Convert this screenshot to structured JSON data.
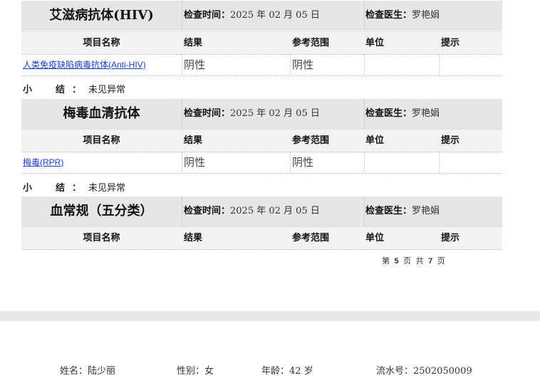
{
  "sections": [
    {
      "title": "艾滋病抗体(HIV)",
      "check_time_label": "检查时间：",
      "check_time": "2025 年 02 月 05 日",
      "doctor_label": "检查医生：",
      "doctor": "罗艳娟",
      "columns": [
        "项目名称",
        "结果",
        "参考范围",
        "单位",
        "提示"
      ],
      "rows": [
        {
          "name": "人类免疫缺陷病毒抗体(Anti-HIV)",
          "result": "阴性",
          "range": "阴性",
          "unit": "",
          "hint": ""
        }
      ],
      "summary_label": "小　结：",
      "summary": "未见异常"
    },
    {
      "title": "梅毒血清抗体",
      "check_time_label": "检查时间：",
      "check_time": "2025 年 02 月 05 日",
      "doctor_label": "检查医生：",
      "doctor": "罗艳娟",
      "columns": [
        "项目名称",
        "结果",
        "参考范围",
        "单位",
        "提示"
      ],
      "rows": [
        {
          "name": "梅毒(RPR)",
          "result": "阴性",
          "range": "阴性",
          "unit": "",
          "hint": ""
        }
      ],
      "summary_label": "小　结：",
      "summary": "未见异常"
    },
    {
      "title": "血常规（五分类）",
      "check_time_label": "检查时间：",
      "check_time": "2025 年 02 月 05 日",
      "doctor_label": "检查医生：",
      "doctor": "罗艳娟",
      "columns": [
        "项目名称",
        "结果",
        "参考范围",
        "单位",
        "提示"
      ]
    }
  ],
  "pager": {
    "prefix": "第",
    "current": "5",
    "middle": "页 共",
    "total": "7",
    "suffix": "页"
  },
  "footer": {
    "name": "姓名：陆少丽",
    "gender": "性别：女",
    "age": "年龄：42 岁",
    "serial": "流水号：2502050009"
  }
}
